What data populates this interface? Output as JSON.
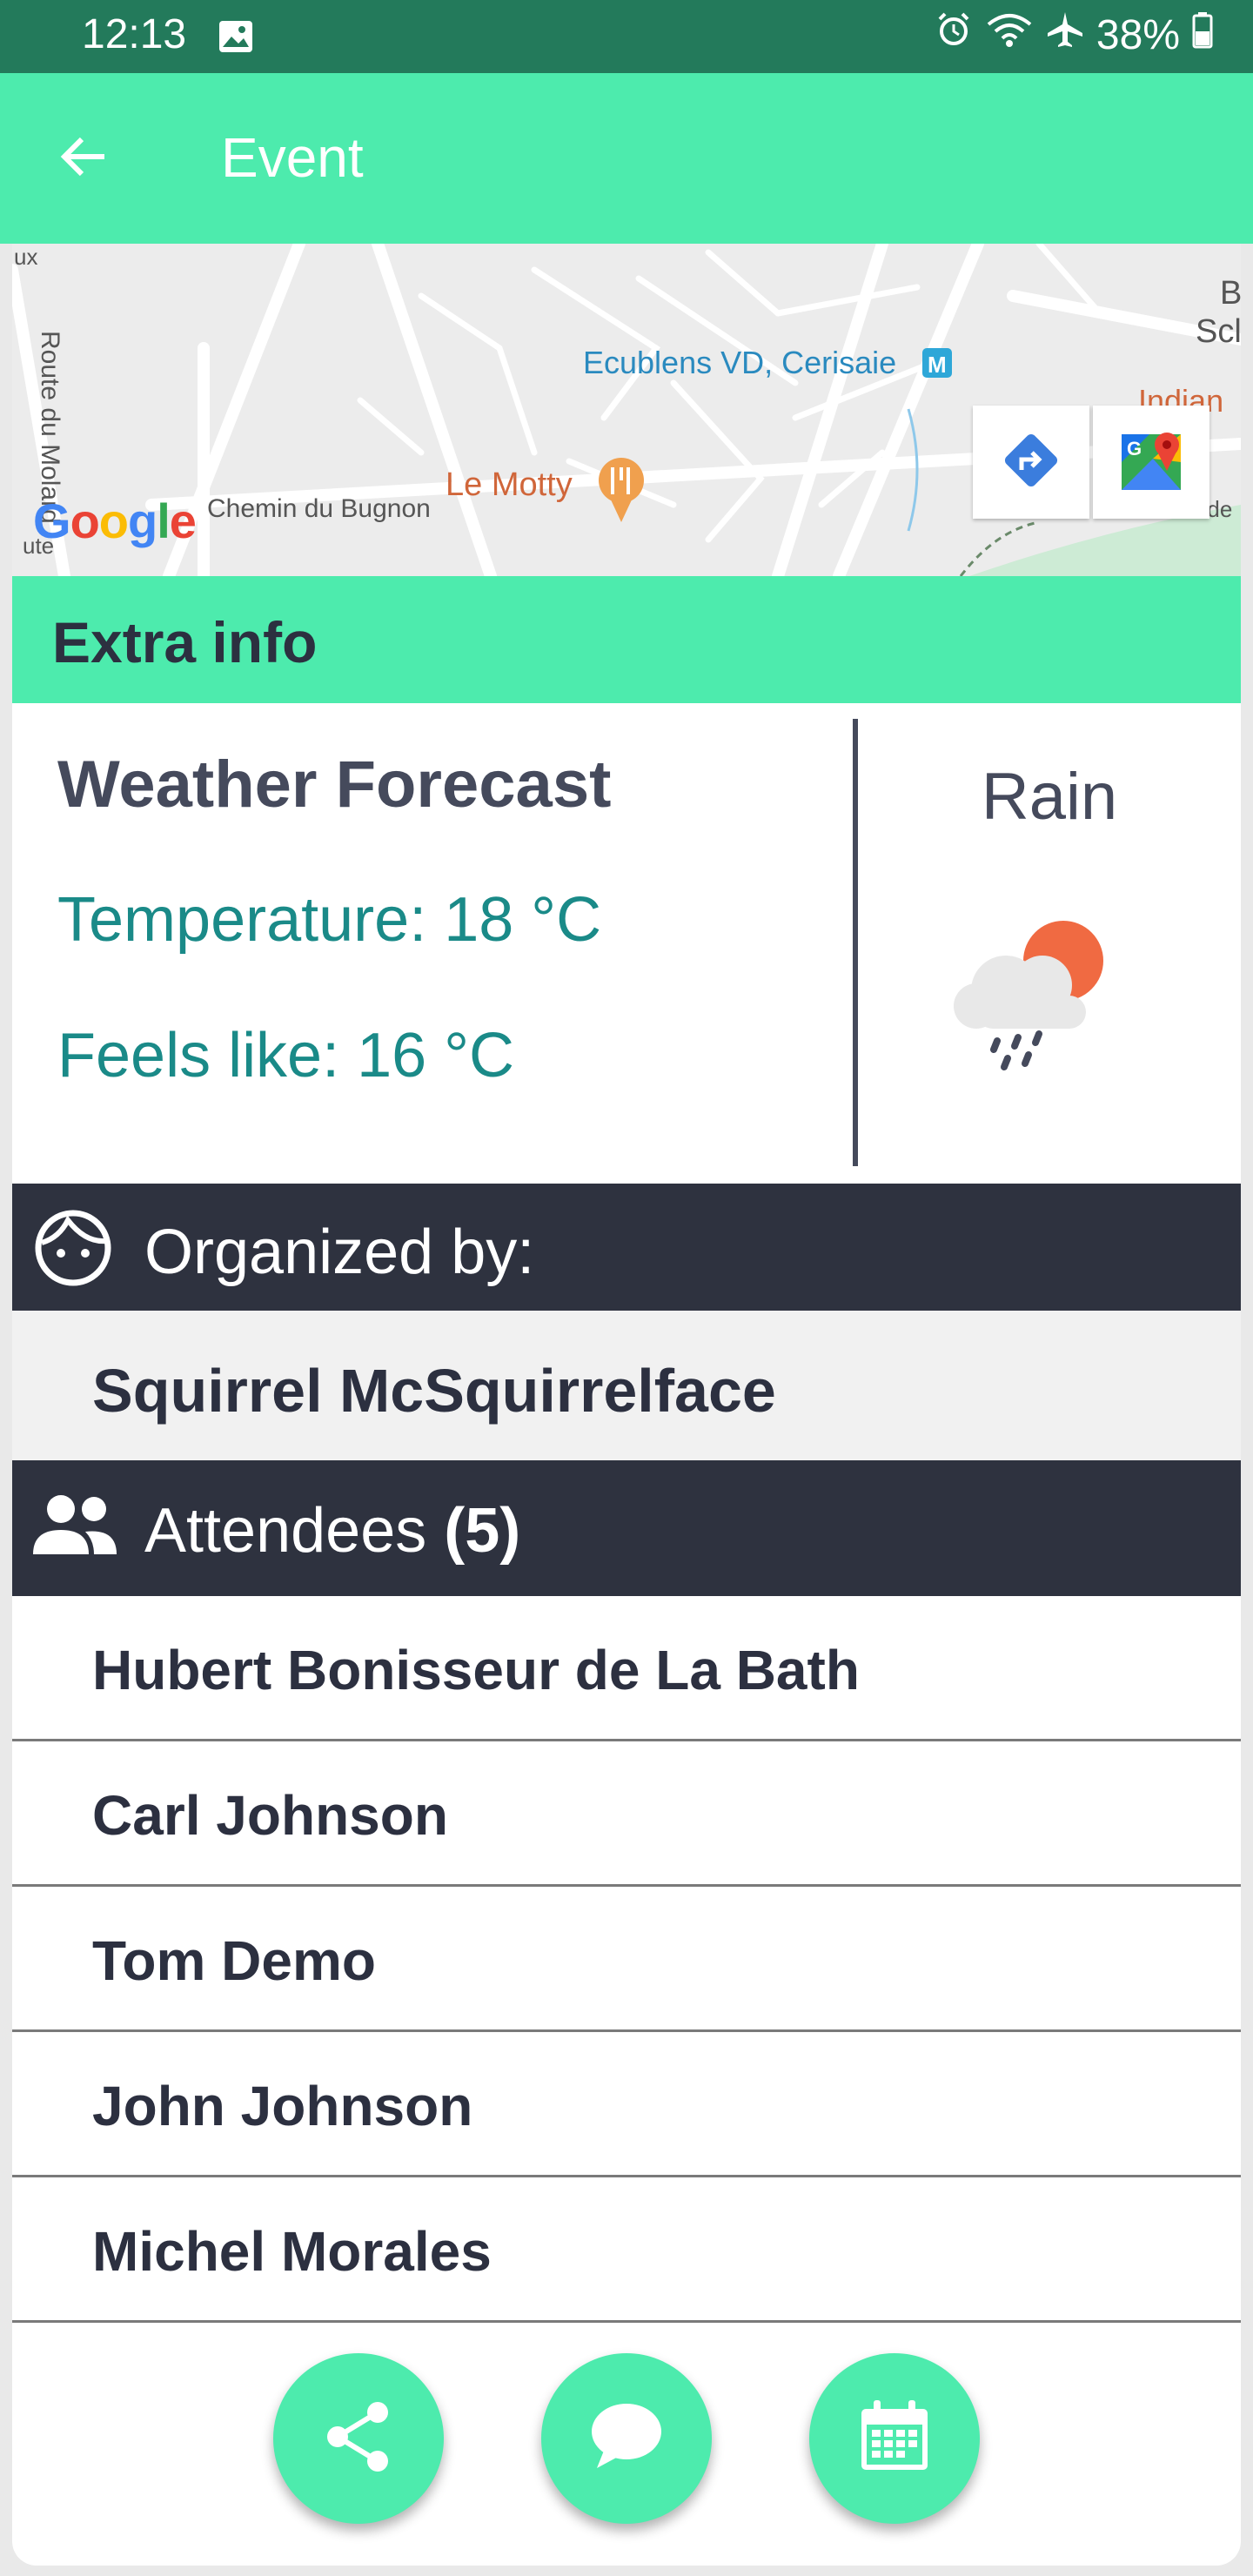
{
  "status_bar": {
    "time": "12:13",
    "battery": "38%"
  },
  "app_bar": {
    "title": "Event"
  },
  "map": {
    "labels": {
      "road_molard": "Route du Molard",
      "road_bugnon": "Chemin du Bugnon",
      "station": "Ecublens VD, Cerisaie",
      "restaurant": "Le Motty",
      "indian": "Indian",
      "corner_b": "B",
      "corner_sc": "Scl",
      "route_de": "ute de",
      "ux": "ux",
      "ute": "ute"
    },
    "attribution": "Google"
  },
  "extra_info": {
    "title": "Extra info"
  },
  "weather": {
    "title": "Weather Forecast",
    "temperature": "Temperature: 18 °C",
    "feels_like": "Feels like: 16 °C",
    "condition": "Rain"
  },
  "organizer": {
    "header": "Organized by:",
    "name": "Squirrel McSquirrelface"
  },
  "attendees": {
    "header": "Attendees",
    "count": "(5)",
    "items": [
      "Hubert Bonisseur de La Bath",
      "Carl Johnson",
      "Tom Demo",
      "John Johnson",
      "Michel Morales"
    ]
  },
  "colors": {
    "accent": "#4debad",
    "status_bar": "#237a5b",
    "section_dark": "#2e323f",
    "teal_text": "#1a8a88"
  },
  "icons": {
    "back": "arrow-left-icon",
    "face": "face-icon",
    "people": "people-icon",
    "share": "share-icon",
    "chat": "chat-icon",
    "calendar": "calendar-icon"
  }
}
